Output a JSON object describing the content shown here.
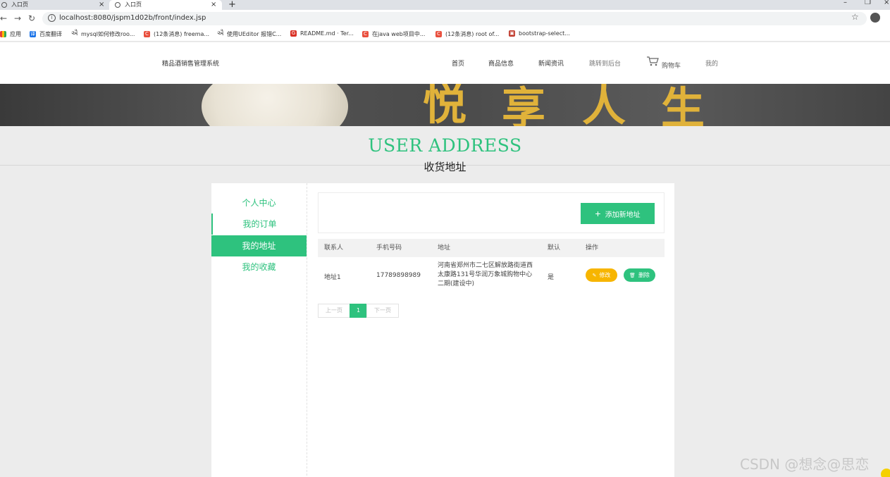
{
  "browser": {
    "tabs": [
      {
        "label": "入口页"
      },
      {
        "label": "入口页"
      }
    ],
    "url": "localhost:8080/jspm1d02b/front/index.jsp",
    "bookmarks": [
      {
        "label": "应用",
        "icon": "apps-grid-icon"
      },
      {
        "label": "百度翻译",
        "icon": "baidu-translate-icon"
      },
      {
        "label": "mysql如何修改roo...",
        "icon": "page-icon"
      },
      {
        "label": "(12条消息) freema...",
        "icon": "csdn-icon"
      },
      {
        "label": "使用UEditor 报错C...",
        "icon": "page-icon"
      },
      {
        "label": "README.md · Ter...",
        "icon": "gitee-icon"
      },
      {
        "label": "在java web项目中...",
        "icon": "csdn-icon"
      },
      {
        "label": "(12条消息) root of...",
        "icon": "csdn-icon"
      },
      {
        "label": "bootstrap-select...",
        "icon": "bootstrap-icon"
      }
    ]
  },
  "header": {
    "site_title": "精品酒销售管理系统",
    "nav": [
      {
        "label": "首页"
      },
      {
        "label": "商品信息"
      },
      {
        "label": "新闻资讯"
      },
      {
        "label": "跳转到后台"
      },
      {
        "label": "购物车"
      },
      {
        "label": "我的"
      }
    ]
  },
  "banner": {
    "glyphs": [
      "悦",
      "享",
      "人",
      "生"
    ]
  },
  "heading": {
    "en": "USER ADDRESS",
    "zh": "收货地址"
  },
  "sidebar": {
    "items": [
      {
        "label": "个人中心"
      },
      {
        "label": "我的订单"
      },
      {
        "label": "我的地址"
      },
      {
        "label": "我的收藏"
      }
    ]
  },
  "toolbar": {
    "add_label": "添加新地址"
  },
  "table": {
    "headers": [
      "联系人",
      "手机号码",
      "地址",
      "默认",
      "操作"
    ],
    "rows": [
      {
        "contact": "地址1",
        "phone": "17789898989",
        "address": "河南省郑州市二七区解放路街道西太康路131号华润万象城购物中心二期(建设中)",
        "default": "是",
        "edit_label": "修改",
        "delete_label": "删除"
      }
    ]
  },
  "pagination": {
    "prev": "上一页",
    "current": "1",
    "next": "下一页"
  },
  "watermark": "CSDN @想念@思恋",
  "colors": {
    "accent": "#2ec27e",
    "edit": "#f7b500"
  }
}
